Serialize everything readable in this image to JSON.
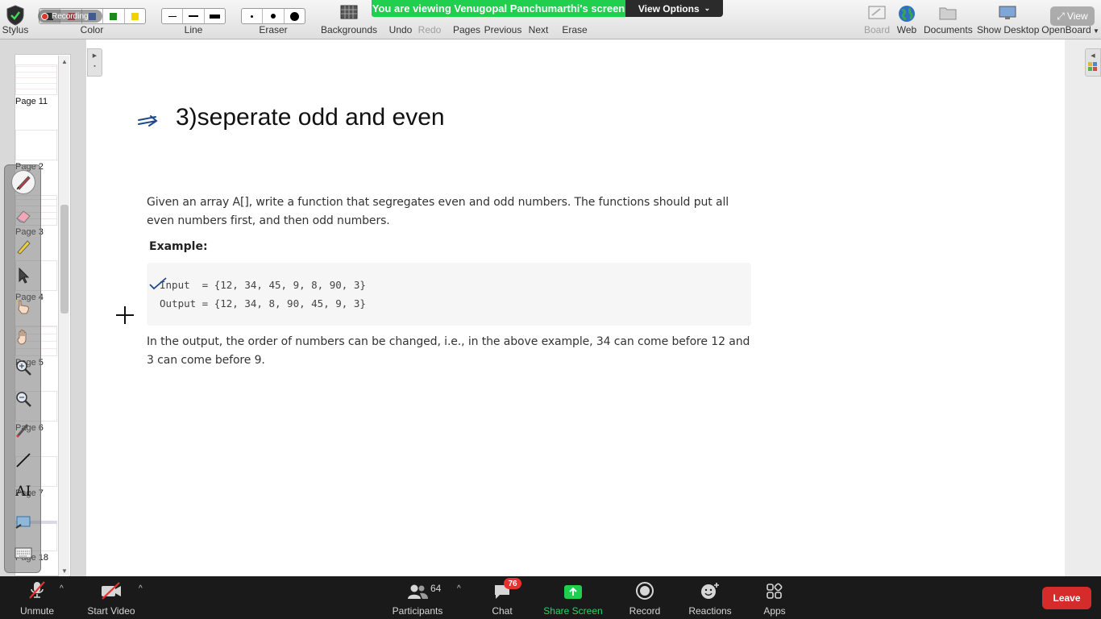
{
  "toolbar": {
    "stylus_label": "Stylus",
    "color_label": "Color",
    "line_label": "Line",
    "eraser_label": "Eraser",
    "backgrounds_label": "Backgrounds",
    "undo_label": "Undo",
    "redo_label": "Redo",
    "pages_label": "Pages",
    "previous_label": "Previous",
    "next_label": "Next",
    "erase_label": "Erase",
    "board_label": "Board",
    "web_label": "Web",
    "documents_label": "Documents",
    "show_desktop_label": "Show Desktop",
    "openboard_label": "OpenBoard",
    "colors": [
      "#000000",
      "#e63b3b",
      "#2b6cd6",
      "#1a8a1a",
      "#f2d200"
    ]
  },
  "recording": {
    "label": "Recording"
  },
  "share_banner": {
    "text": "You are viewing Venugopal Panchumarthi's screen",
    "view_options": "View Options",
    "view_pill": "View"
  },
  "thumbnails": {
    "pages": [
      "Page 11",
      "Page 2",
      "Page 3",
      "Page 4",
      "Page 5",
      "Page 6",
      "Page 7",
      "Page 18"
    ]
  },
  "board": {
    "title": "3)seperate odd and even",
    "description": "Given an array A[], write a function that segregates even and odd numbers. The functions should put all even numbers first, and then odd numbers.",
    "example_label": "Example:",
    "code_input": "Input  = {12, 34, 45, 9, 8, 90, 3}",
    "code_output": "Output = {12, 34, 8, 90, 45, 9, 3}",
    "note": "In the output, the order of numbers can be changed, i.e., in the above example, 34 can come before 12 and 3 can come before 9."
  },
  "zoom": {
    "unmute": "Unmute",
    "start_video": "Start Video",
    "participants": "Participants",
    "participants_count": "64",
    "chat": "Chat",
    "chat_badge": "76",
    "share_screen": "Share Screen",
    "record": "Record",
    "reactions": "Reactions",
    "apps": "Apps",
    "leave": "Leave"
  }
}
